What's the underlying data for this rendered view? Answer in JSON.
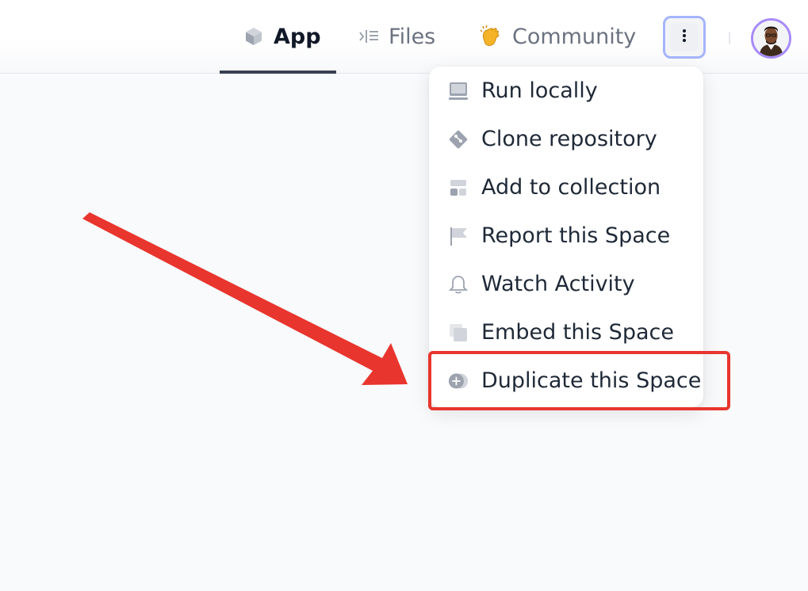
{
  "tabs": {
    "app": "App",
    "files": "Files",
    "community": "Community"
  },
  "menu": {
    "items": [
      {
        "label": "Run locally",
        "icon": "computer-icon"
      },
      {
        "label": "Clone repository",
        "icon": "git-icon"
      },
      {
        "label": "Add to collection",
        "icon": "collection-icon"
      },
      {
        "label": "Report this Space",
        "icon": "flag-icon"
      },
      {
        "label": "Watch Activity",
        "icon": "bell-icon"
      },
      {
        "label": "Embed this Space",
        "icon": "embed-icon"
      },
      {
        "label": "Duplicate this Space",
        "icon": "duplicate-icon"
      }
    ]
  },
  "colors": {
    "annotation_red": "#e8352e",
    "active_tab_underline": "#374151",
    "focus_ring": "#a5b4fc",
    "avatar_ring": "#a78bfa"
  }
}
